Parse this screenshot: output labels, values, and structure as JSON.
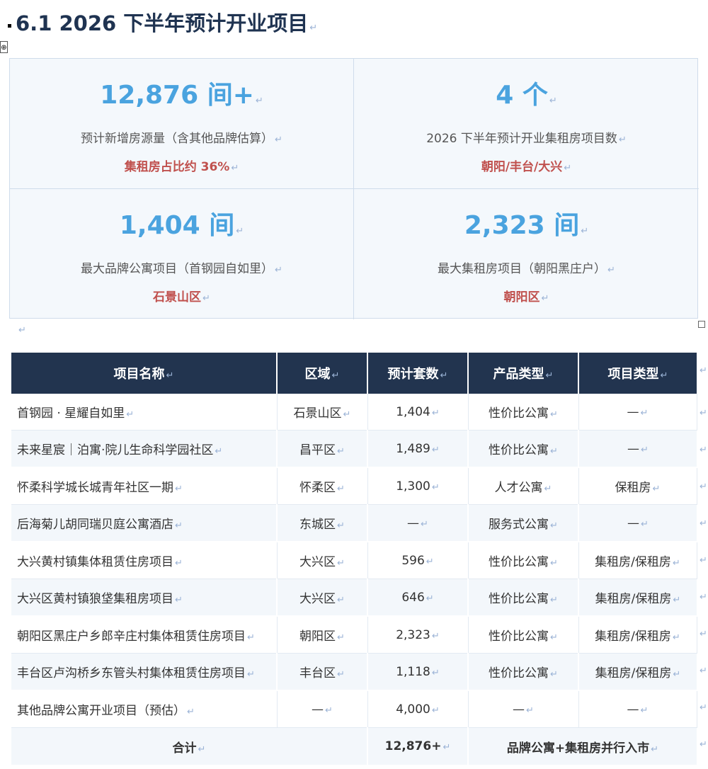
{
  "section": {
    "title": "6.1 2026 下半年预计开业项目"
  },
  "marks": {
    "para": "↵",
    "move": "⊕"
  },
  "stats": [
    {
      "value": "12,876 间+",
      "desc": "预计新增房源量（含其他品牌估算）",
      "tag": "集租房占比约 36%"
    },
    {
      "value": "4 个",
      "desc": "2026 下半年预计开业集租房项目数",
      "tag": "朝阳/丰台/大兴"
    },
    {
      "value": "1,404 间",
      "desc": "最大品牌公寓项目（首钢园自如里）",
      "tag": "石景山区"
    },
    {
      "value": "2,323 间",
      "desc": "最大集租房项目（朝阳黑庄户）",
      "tag": "朝阳区"
    }
  ],
  "table": {
    "headers": [
      "项目名称",
      "区域",
      "预计套数",
      "产品类型",
      "项目类型"
    ],
    "rows": [
      [
        "首钢园 · 星耀自如里",
        "石景山区",
        "1,404",
        "性价比公寓",
        "—"
      ],
      [
        "未来星宸｜泊寓·院儿生命科学园社区",
        "昌平区",
        "1,489",
        "性价比公寓",
        "—"
      ],
      [
        "怀柔科学城长城青年社区一期",
        "怀柔区",
        "1,300",
        "人才公寓",
        "保租房"
      ],
      [
        "后海菊儿胡同瑞贝庭公寓酒店",
        "东城区",
        "—",
        "服务式公寓",
        "—"
      ],
      [
        "大兴黄村镇集体租赁住房项目",
        "大兴区",
        "596",
        "性价比公寓",
        "集租房/保租房"
      ],
      [
        "大兴区黄村镇狼垡集租房项目",
        "大兴区",
        "646",
        "性价比公寓",
        "集租房/保租房"
      ],
      [
        "朝阳区黑庄户乡郎辛庄村集体租赁住房项目",
        "朝阳区",
        "2,323",
        "性价比公寓",
        "集租房/保租房"
      ],
      [
        "丰台区卢沟桥乡东管头村集体租赁住房项目",
        "丰台区",
        "1,118",
        "性价比公寓",
        "集租房/保租房"
      ],
      [
        "其他品牌公寓开业项目（预估）",
        "—",
        "4,000",
        "—",
        "—"
      ]
    ],
    "total": {
      "label": "合计",
      "count": "12,876+",
      "note": "品牌公寓+集租房并行入市"
    }
  }
}
